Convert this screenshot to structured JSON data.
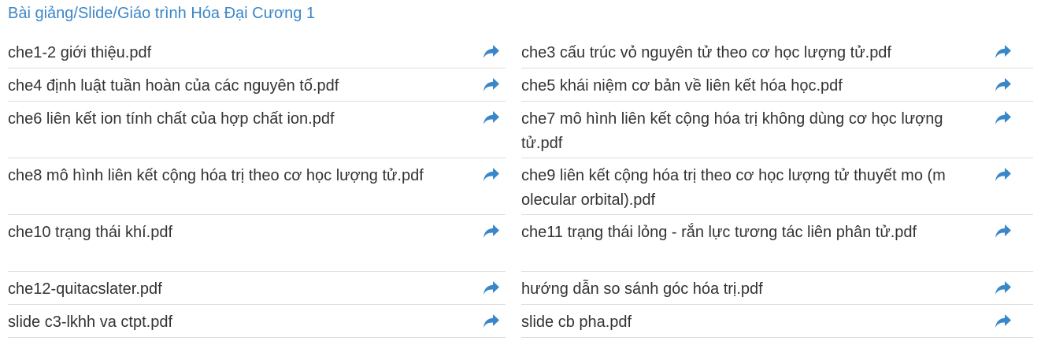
{
  "folder": {
    "title": "Bài giảng/Slide/Giáo trình Hóa Đại Cương 1"
  },
  "icons": {
    "share": "share-arrow-icon"
  },
  "colors": {
    "accent": "#3a87c8",
    "text": "#333333",
    "divider": "#dddddd"
  },
  "files": [
    {
      "name": "che1-2 giới thiệu.pdf"
    },
    {
      "name": "che3 cấu trúc vỏ nguyên tử theo cơ học lượng tử.pdf"
    },
    {
      "name": "che4 định luật tuần hoàn của các nguyên tố.pdf"
    },
    {
      "name": "che5 khái niệm cơ bản về liên kết hóa học.pdf"
    },
    {
      "name": "che6 liên kết ion tính chất của hợp chất ion.pdf"
    },
    {
      "name": "che7 mô hình liên kết cộng hóa trị không dùng cơ học lượng tử.pdf"
    },
    {
      "name": "che8 mô hình liên kết cộng hóa trị theo cơ học lượng tử.pdf"
    },
    {
      "name": "che9 liên kết cộng hóa trị theo cơ học lượng tử thuyết mo (molecular orbital).pdf"
    },
    {
      "name": "che10 trạng thái khí.pdf"
    },
    {
      "name": "che11 trạng thái lỏng - rắn lực tương tác liên phân tử.pdf"
    },
    {
      "name": "che12-quitacslater.pdf"
    },
    {
      "name": "hướng dẫn so sánh góc hóa trị.pdf"
    },
    {
      "name": "slide c3-lkhh va ctpt.pdf"
    },
    {
      "name": "slide cb pha.pdf"
    }
  ]
}
